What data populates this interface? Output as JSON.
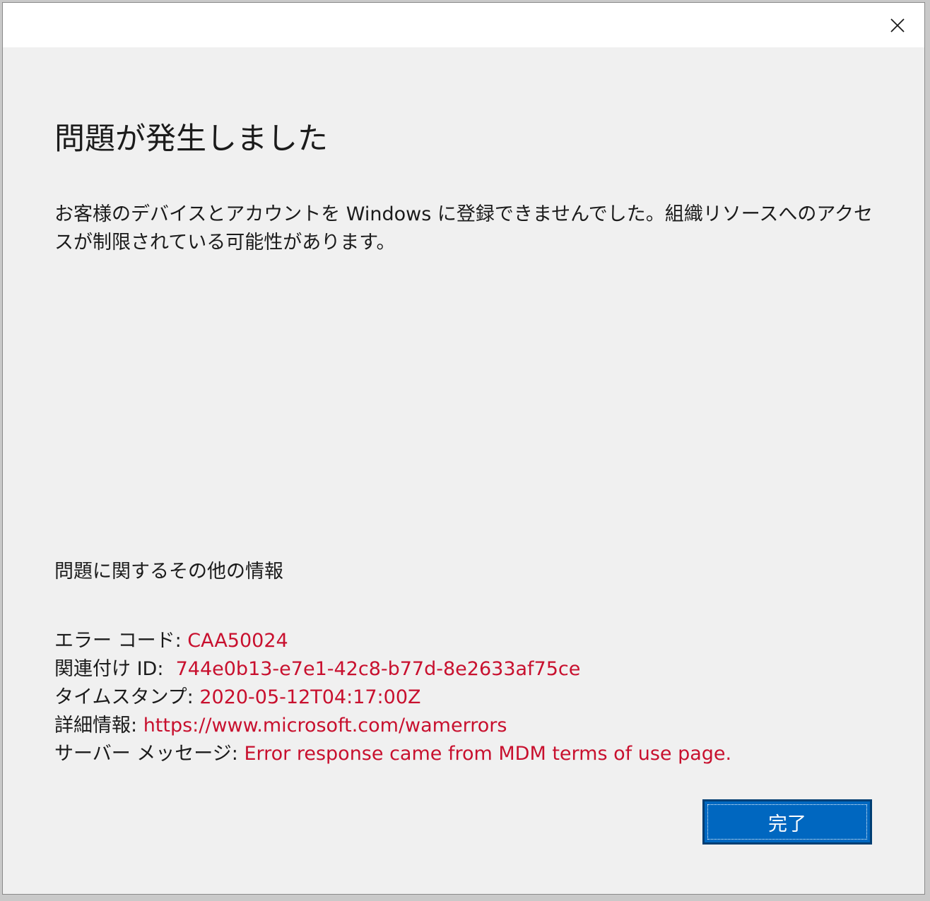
{
  "dialog": {
    "close_icon": "close-icon",
    "title": "問題が発生しました",
    "message": "お客様のデバイスとアカウントを Windows に登録できませんでした。組織リソースへのアクセスが制限されている可能性があります。",
    "more_info_title": "問題に関するその他の情報",
    "details": [
      {
        "label": "エラー コード: ",
        "value": "CAA50024"
      },
      {
        "label": "関連付け ID:  ",
        "value": "744e0b13-e7e1-42c8-b77d-8e2633af75ce"
      },
      {
        "label": "タイムスタンプ: ",
        "value": "2020-05-12T04:17:00Z"
      },
      {
        "label": "詳細情報: ",
        "value": "https://www.microsoft.com/wamerrors"
      },
      {
        "label": "サーバー メッセージ: ",
        "value": "Error response came from MDM terms of use page."
      }
    ],
    "done_label": "完了",
    "colors": {
      "background": "#f0f0f0",
      "value_text": "#c8102e",
      "button": "#0067c0"
    }
  }
}
